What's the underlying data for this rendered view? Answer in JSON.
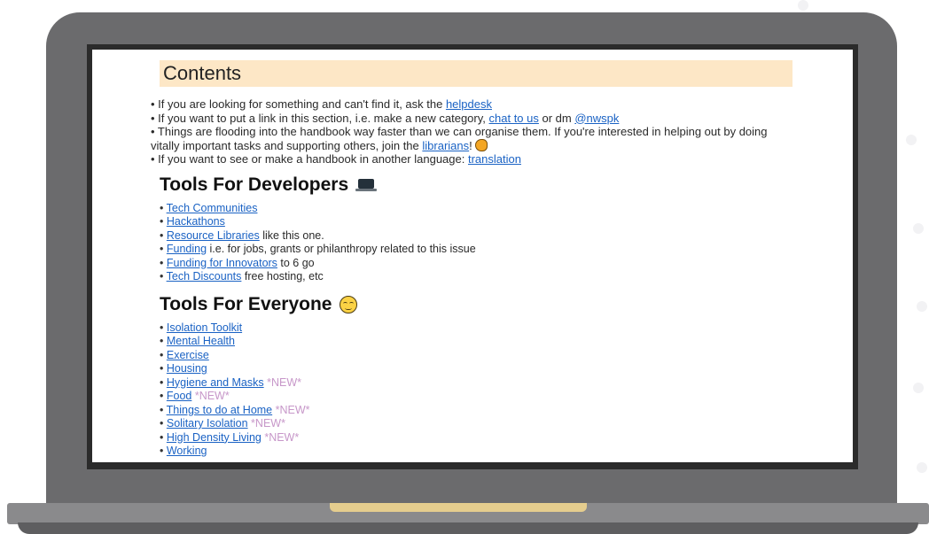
{
  "contents": {
    "title": "Contents",
    "intro": [
      {
        "pre": "• If you are looking for something and can't find it, ask the ",
        "link": "helpdesk",
        "post": ""
      },
      {
        "pre": "• If you want to put a link in this section, i.e. make a new category, ",
        "link": "chat to us",
        "mid": " or dm ",
        "link2": "@nwspk",
        "post": ""
      },
      {
        "pre": "• Things are flooding into the handbook way faster than we can organise them. If you're interested in helping out by doing vitally important tasks and supporting others, join the ",
        "link": "librarians",
        "post": "! "
      },
      {
        "pre": "• If you want to see or make a handbook in another language: ",
        "link": "translation",
        "post": ""
      }
    ]
  },
  "developers": {
    "heading": "Tools For Developers",
    "icon": "laptop-icon",
    "items": [
      {
        "link": "Tech Communities",
        "text": ""
      },
      {
        "link": "Hackathons",
        "text": ""
      },
      {
        "link": "Resource Libraries",
        "text": " like this one."
      },
      {
        "link": "Funding",
        "text": " i.e. for jobs, grants or philanthropy related to this issue"
      },
      {
        "link": "Funding for Innovators",
        "text": " to 6 go"
      },
      {
        "link": "Tech Discounts",
        "text": " free hosting, etc"
      }
    ]
  },
  "everyone": {
    "heading": "Tools For Everyone",
    "icon": "relieved-face-icon",
    "items": [
      {
        "link": "Isolation Toolkit",
        "tag": ""
      },
      {
        "link": "Mental Health",
        "tag": ""
      },
      {
        "link": "Exercise",
        "tag": ""
      },
      {
        "link": "Housing",
        "tag": ""
      },
      {
        "link": "Hygiene and Masks",
        "tag": " *NEW*"
      },
      {
        "link": "Food",
        "tag": " *NEW*"
      },
      {
        "link": "Things to do at Home",
        "tag": " *NEW*"
      },
      {
        "link": "Solitary Isolation",
        "tag": " *NEW*"
      },
      {
        "link": "High Density Living",
        "tag": " *NEW*"
      },
      {
        "link": "Working",
        "tag": ""
      }
    ]
  },
  "colors": {
    "link": "#1a62c4",
    "new_tag": "#c797c9",
    "contents_bar": "#fde7c6",
    "laptop_body": "#6b6b6d"
  }
}
